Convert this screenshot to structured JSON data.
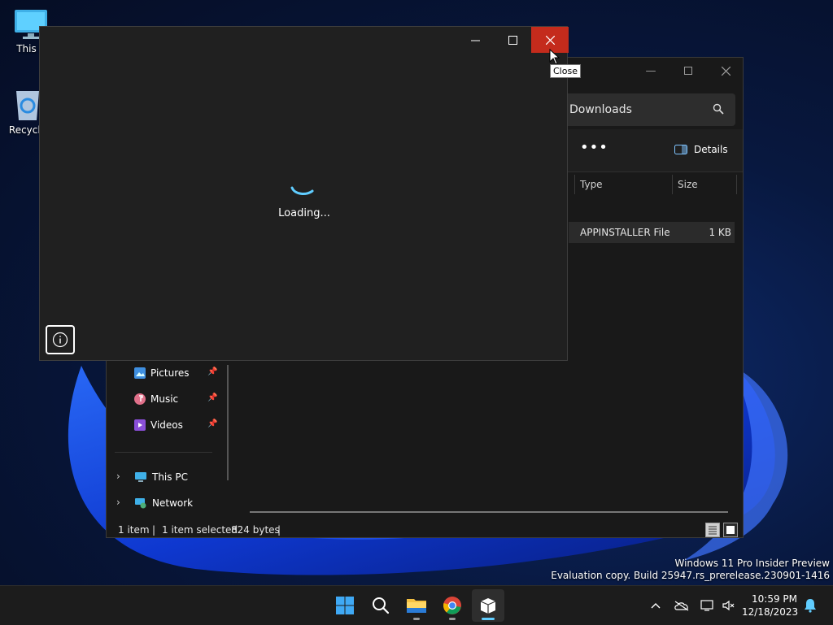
{
  "desktop": {
    "icons": [
      {
        "label": "This PC",
        "visible_label": "This P",
        "icon": "monitor-icon"
      },
      {
        "label": "Recycle Bin",
        "visible_label": "Recycle",
        "icon": "recycle-bin-icon"
      }
    ],
    "watermark": {
      "line1": "Windows 11 Pro Insider Preview",
      "line2": "Evaluation copy. Build 25947.rs_prerelease.230901-1416"
    }
  },
  "loading_window": {
    "loading_text": "Loading...",
    "tooltip": "Close",
    "info_icon": "info-icon",
    "close_hovered": true
  },
  "explorer": {
    "address": "Downloads",
    "toolbar": {
      "more_label": "•••",
      "details_label": "Details"
    },
    "columns": [
      "Type",
      "Size"
    ],
    "file": {
      "type": "APPINSTALLER File",
      "size": "1 KB"
    },
    "nav": {
      "quick_access": [
        {
          "label": "Pictures",
          "icon": "pictures-icon",
          "pinned": true
        },
        {
          "label": "Music",
          "icon": "music-icon",
          "pinned": true
        },
        {
          "label": "Videos",
          "icon": "videos-icon",
          "pinned": true
        }
      ],
      "locations": [
        {
          "label": "This PC",
          "icon": "this-pc-icon"
        },
        {
          "label": "Network",
          "icon": "network-icon"
        }
      ]
    },
    "status": {
      "count": "1 item",
      "selected": "1 item selected",
      "size": "824 bytes"
    }
  },
  "taskbar": {
    "apps": [
      {
        "name": "Start",
        "icon": "windows-start-icon"
      },
      {
        "name": "Search",
        "icon": "search-icon"
      },
      {
        "name": "File Explorer",
        "icon": "folder-icon",
        "running": true
      },
      {
        "name": "Google Chrome",
        "icon": "chrome-icon",
        "running": true
      },
      {
        "name": "App Installer",
        "icon": "package-icon",
        "running": true,
        "active": true
      }
    ],
    "clock": {
      "time": "10:59 PM",
      "date": "12/18/2023"
    }
  },
  "colors": {
    "close_red": "#c42b1c",
    "accent": "#60cdff",
    "window_bg": "#202020"
  }
}
